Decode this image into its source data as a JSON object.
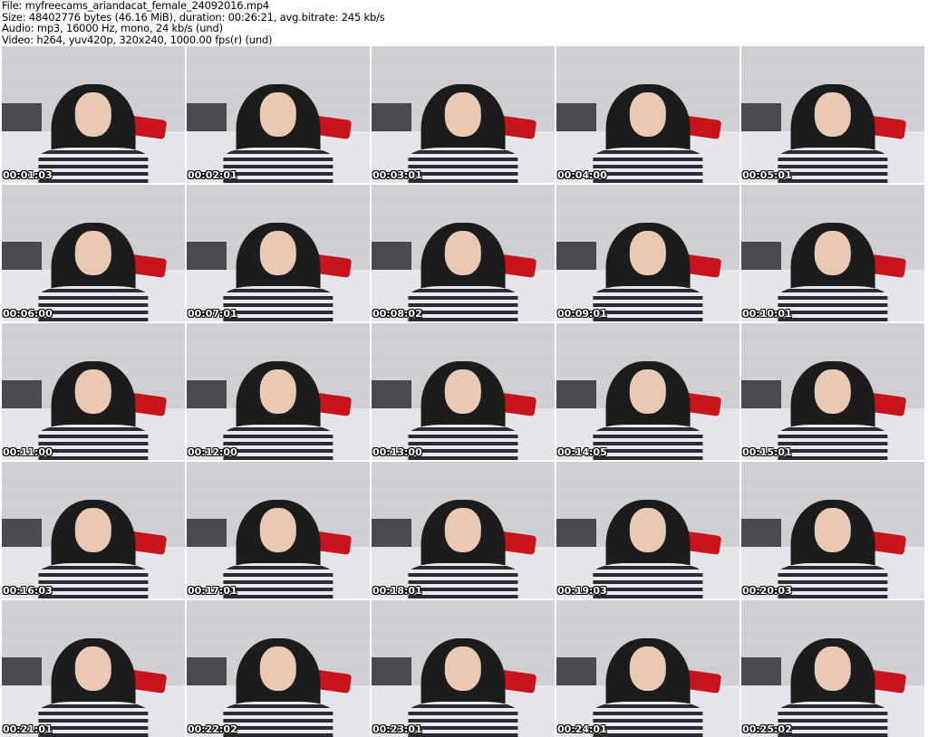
{
  "header": {
    "file": "File: myfreecams_ariandacat_female_24092016.mp4",
    "size": "Size: 48402776 bytes (46.16 MiB), duration: 00:26:21, avg.bitrate: 245 kb/s",
    "audio": "Audio: mp3, 16000 Hz, mono, 24 kb/s (und)",
    "video": "Video: h264, yuv420p, 320x240, 1000.00 fps(r) (und)"
  },
  "thumbnails": [
    "00:01:03",
    "00:02:01",
    "00:03:01",
    "00:04:00",
    "00:05:01",
    "00:06:00",
    "00:07:01",
    "00:08:02",
    "00:09:01",
    "00:10:01",
    "00:11:00",
    "00:12:00",
    "00:13:00",
    "00:14:05",
    "00:15:01",
    "00:16:03",
    "00:17:01",
    "00:18:01",
    "00:19:03",
    "00:20:03",
    "00:21:01",
    "00:22:02",
    "00:23:01",
    "00:24:01",
    "00:25:02"
  ]
}
